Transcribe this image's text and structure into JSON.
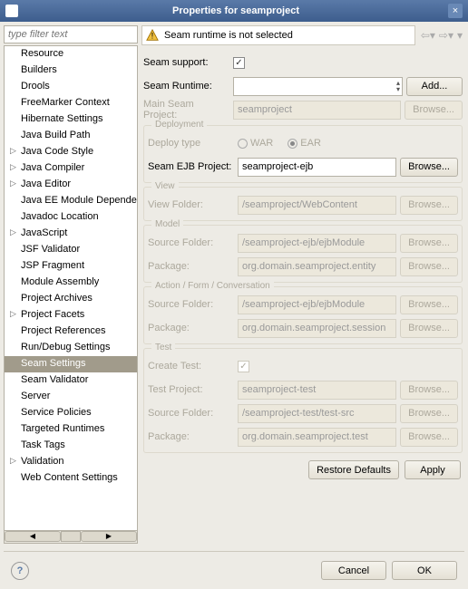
{
  "window": {
    "title": "Properties for seamproject"
  },
  "filter": {
    "placeholder": "type filter text"
  },
  "tree": {
    "items": [
      {
        "label": "Resource",
        "expandable": false
      },
      {
        "label": "Builders",
        "expandable": false
      },
      {
        "label": "Drools",
        "expandable": false
      },
      {
        "label": "FreeMarker Context",
        "expandable": false
      },
      {
        "label": "Hibernate Settings",
        "expandable": false
      },
      {
        "label": "Java Build Path",
        "expandable": false
      },
      {
        "label": "Java Code Style",
        "expandable": true
      },
      {
        "label": "Java Compiler",
        "expandable": true
      },
      {
        "label": "Java Editor",
        "expandable": true
      },
      {
        "label": "Java EE Module Dependencies",
        "expandable": false
      },
      {
        "label": "Javadoc Location",
        "expandable": false
      },
      {
        "label": "JavaScript",
        "expandable": true
      },
      {
        "label": "JSF Validator",
        "expandable": false
      },
      {
        "label": "JSP Fragment",
        "expandable": false
      },
      {
        "label": "Module Assembly",
        "expandable": false
      },
      {
        "label": "Project Archives",
        "expandable": false
      },
      {
        "label": "Project Facets",
        "expandable": true
      },
      {
        "label": "Project References",
        "expandable": false
      },
      {
        "label": "Run/Debug Settings",
        "expandable": false
      },
      {
        "label": "Seam Settings",
        "expandable": false,
        "selected": true
      },
      {
        "label": "Seam Validator",
        "expandable": false
      },
      {
        "label": "Server",
        "expandable": false
      },
      {
        "label": "Service Policies",
        "expandable": false
      },
      {
        "label": "Targeted Runtimes",
        "expandable": false
      },
      {
        "label": "Task Tags",
        "expandable": false
      },
      {
        "label": "Validation",
        "expandable": true
      },
      {
        "label": "Web Content Settings",
        "expandable": false
      }
    ]
  },
  "banner": {
    "message": "Seam runtime is not selected"
  },
  "form": {
    "seam_support": "Seam support:",
    "seam_runtime": "Seam Runtime:",
    "add": "Add...",
    "main_project_lbl": "Main Seam Project:",
    "main_project_val": "seamproject",
    "browse": "Browse...",
    "deployment": {
      "title": "Deployment",
      "deploy_type": "Deploy type",
      "war": "WAR",
      "ear": "EAR",
      "ejb_lbl": "Seam EJB Project:",
      "ejb_val": "seamproject-ejb"
    },
    "view": {
      "title": "View",
      "folder_lbl": "View Folder:",
      "folder_val": "/seamproject/WebContent"
    },
    "model": {
      "title": "Model",
      "src_lbl": "Source Folder:",
      "src_val": "/seamproject-ejb/ejbModule",
      "pkg_lbl": "Package:",
      "pkg_val": "org.domain.seamproject.entity"
    },
    "action": {
      "title": "Action / Form / Conversation",
      "src_lbl": "Source Folder:",
      "src_val": "/seamproject-ejb/ejbModule",
      "pkg_lbl": "Package:",
      "pkg_val": "org.domain.seamproject.session"
    },
    "test": {
      "title": "Test",
      "create_lbl": "Create Test:",
      "proj_lbl": "Test Project:",
      "proj_val": "seamproject-test",
      "src_lbl": "Source Folder:",
      "src_val": "/seamproject-test/test-src",
      "pkg_lbl": "Package:",
      "pkg_val": "org.domain.seamproject.test"
    },
    "restore": "Restore Defaults",
    "apply": "Apply"
  },
  "footer": {
    "cancel": "Cancel",
    "ok": "OK"
  }
}
